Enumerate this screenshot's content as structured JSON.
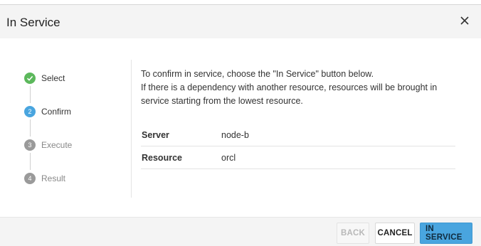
{
  "dialog": {
    "title": "In Service",
    "close_icon": "close-icon"
  },
  "steps": [
    {
      "number": "1",
      "label": "Select",
      "state": "done",
      "icon": "check-icon"
    },
    {
      "number": "2",
      "label": "Confirm",
      "state": "active"
    },
    {
      "number": "3",
      "label": "Execute",
      "state": "pending"
    },
    {
      "number": "4",
      "label": "Result",
      "state": "pending"
    }
  ],
  "content": {
    "description_line1": "To confirm in service, choose the \"In Service\" button below.",
    "description_line2": "If there is a dependency with another resource, resources will be brought in",
    "description_line3": "service starting from the lowest resource.",
    "rows": [
      {
        "key": "Server",
        "value": "node-b"
      },
      {
        "key": "Resource",
        "value": "orcl"
      }
    ]
  },
  "footer": {
    "back_label": "BACK",
    "cancel_label": "CANCEL",
    "in_service_label": "IN SERVICE"
  },
  "colors": {
    "step_done": "#5cb85c",
    "step_active": "#49a5df",
    "step_pending": "#9a9a9a",
    "primary_button": "#49a5df"
  }
}
